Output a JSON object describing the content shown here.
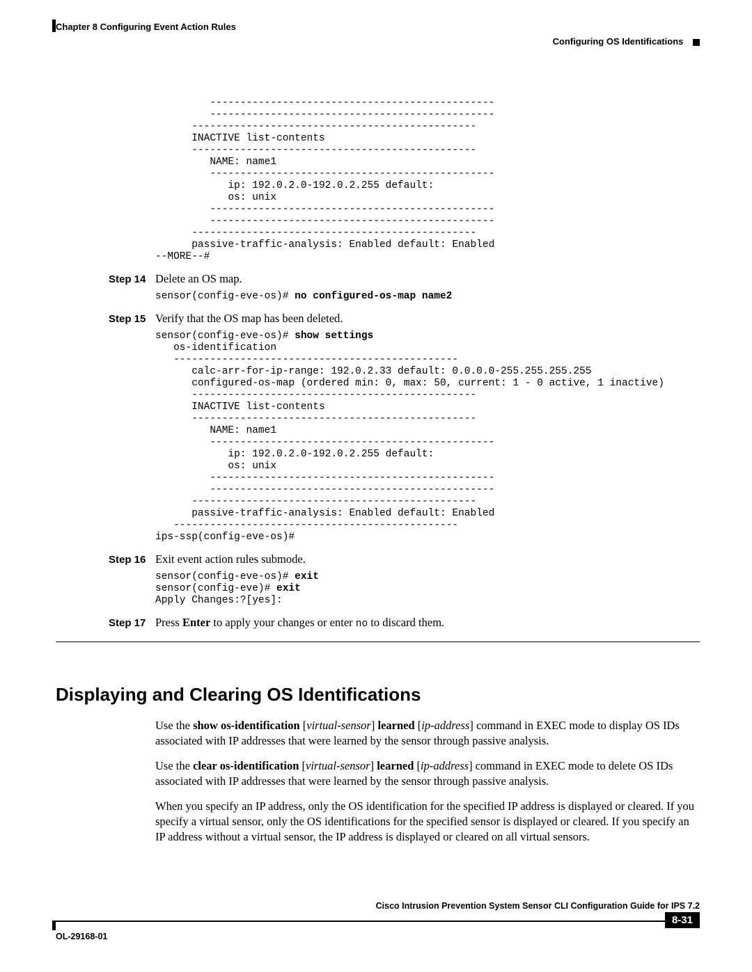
{
  "header": {
    "chapter": "Chapter 8      Configuring Event Action Rules",
    "section": "Configuring OS Identifications"
  },
  "block1": "         -----------------------------------------------\n         -----------------------------------------------\n      -----------------------------------------------\n      INACTIVE list-contents\n      -----------------------------------------------\n         NAME: name1\n         -----------------------------------------------\n            ip: 192.0.2.0-192.0.2.255 default:\n            os: unix\n         -----------------------------------------------\n         -----------------------------------------------\n      -----------------------------------------------\n      passive-traffic-analysis: Enabled default: Enabled\n--MORE--#",
  "step14": {
    "label": "Step 14",
    "text": "Delete an OS map.",
    "code_prompt": "sensor(config-eve-os)# ",
    "code_cmd": "no configured-os-map name2"
  },
  "step15": {
    "label": "Step 15",
    "text": "Verify that the OS map has been deleted.",
    "code_prompt": "sensor(config-eve-os)# ",
    "code_cmd": "show settings",
    "code_body": "   os-identification\n   -----------------------------------------------\n      calc-arr-for-ip-range: 192.0.2.33 default: 0.0.0.0-255.255.255.255\n      configured-os-map (ordered min: 0, max: 50, current: 1 - 0 active, 1 inactive)\n      -----------------------------------------------\n      INACTIVE list-contents\n      -----------------------------------------------\n         NAME: name1\n         -----------------------------------------------\n            ip: 192.0.2.0-192.0.2.255 default:\n            os: unix\n         -----------------------------------------------\n         -----------------------------------------------\n      -----------------------------------------------\n      passive-traffic-analysis: Enabled default: Enabled\n   -----------------------------------------------\nips-ssp(config-eve-os)#"
  },
  "step16": {
    "label": "Step 16",
    "text": "Exit event action rules submode.",
    "code1_prompt": "sensor(config-eve-os)# ",
    "code1_cmd": "exit",
    "code2_prompt": "sensor(config-eve)# ",
    "code2_cmd": "exit",
    "code3": "Apply Changes:?[yes]:"
  },
  "step17": {
    "label": "Step 17",
    "pre": "Press ",
    "kw1": "Enter",
    "mid": " to apply your changes or enter ",
    "cmd": "no",
    "post": " to discard them."
  },
  "section_title": "Displaying and Clearing OS Identifications",
  "para1": {
    "p1": "Use the ",
    "kw1": "show os-identification",
    "sp1": " [",
    "arg1": "virtual-sensor",
    "sp2": "] ",
    "kw2": "learned",
    "sp3": " [",
    "arg2": "ip-address",
    "sp4": "] command in EXEC mode to display OS IDs associated with IP addresses that were learned by the sensor through passive analysis."
  },
  "para2": {
    "p1": "Use the ",
    "kw1": "clear os-identification",
    "sp1": " [",
    "arg1": "virtual-sensor",
    "sp2": "] ",
    "kw2": "learned",
    "sp3": " [",
    "arg2": "ip-address",
    "sp4": "] command in EXEC mode to delete OS IDs associated with IP addresses that were learned by the sensor through passive analysis."
  },
  "para3": "When you specify an IP address, only the OS identification for the specified IP address is displayed or cleared. If you specify a virtual sensor, only the OS identifications for the specified sensor is displayed or cleared. If you specify an IP address without a virtual sensor, the IP address is displayed or cleared on all virtual sensors.",
  "footer": {
    "book": "Cisco Intrusion Prevention System Sensor CLI Configuration Guide for IPS 7.2",
    "docnum": "OL-29168-01",
    "page": "8-31"
  }
}
